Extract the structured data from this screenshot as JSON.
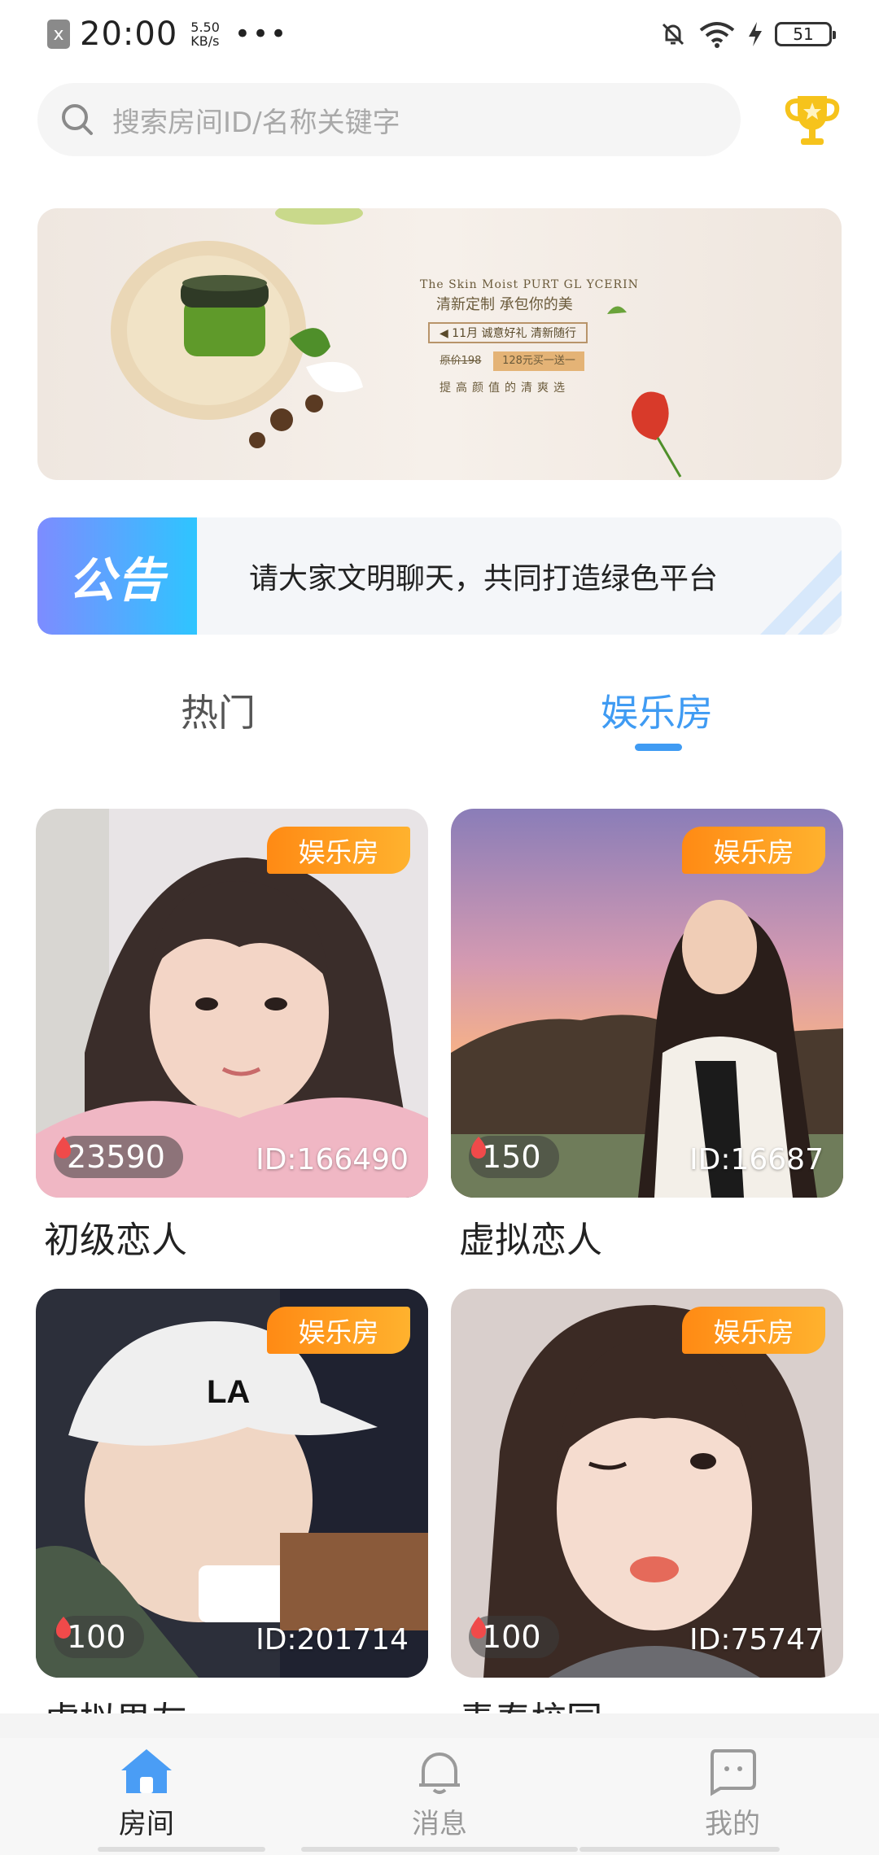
{
  "status_bar": {
    "close_badge": "x",
    "time": "20:00",
    "speed_value": "5.50",
    "speed_unit": "KB/s",
    "more": "•••",
    "battery": "51"
  },
  "search": {
    "placeholder": "搜索房间ID/名称关键字"
  },
  "banner": {
    "line1": "The Skin Moist PURT GL YCERIN",
    "line2": "清新定制 承包你的美",
    "box": "◀ 11月 诚意好礼 清新随行",
    "orig_price": "原价198",
    "deal_price": "128元买一送一",
    "line3": "提高颜值的清爽选"
  },
  "notice": {
    "tag": "公告",
    "text": "请大家文明聊天，共同打造绿色平台"
  },
  "tabs": {
    "hot": "热门",
    "entertainment": "娱乐房"
  },
  "rooms": [
    {
      "badge": "娱乐房",
      "heat": "23590",
      "id": "ID:166490",
      "name": "初级恋人"
    },
    {
      "badge": "娱乐房",
      "heat": "150",
      "id": "ID:16687",
      "name": "虚拟恋人"
    },
    {
      "badge": "娱乐房",
      "heat": "100",
      "id": "ID:201714",
      "name": "虚拟男友"
    },
    {
      "badge": "娱乐房",
      "heat": "100",
      "id": "ID:75747",
      "name": "青春校园"
    }
  ],
  "bottom_nav": {
    "rooms": "房间",
    "messages": "消息",
    "mine": "我的"
  },
  "colors": {
    "accent": "#3f9bf3",
    "badge": "#ff9a1f",
    "trophy": "#f6c31c"
  }
}
